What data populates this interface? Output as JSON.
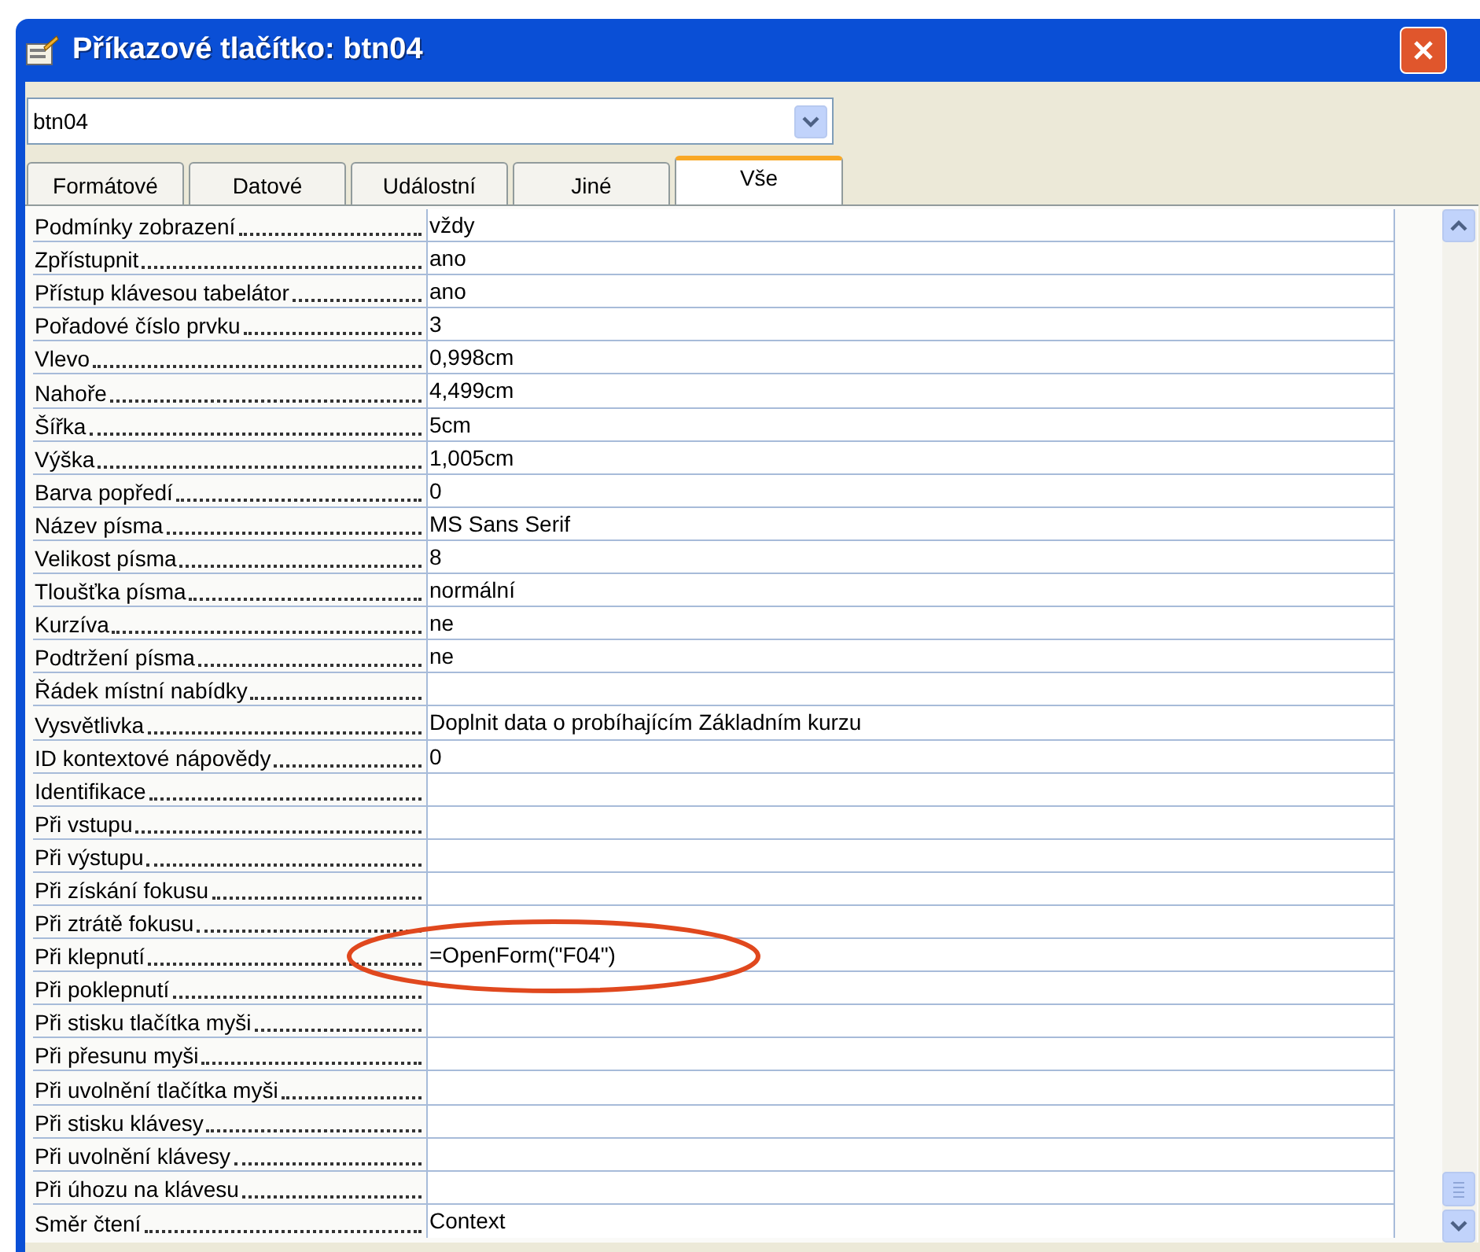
{
  "window": {
    "title": "Příkazové tlačítko: btn04"
  },
  "object_select": {
    "value": "btn04"
  },
  "tabs": [
    {
      "label": "Formátové",
      "selected": false
    },
    {
      "label": "Datové",
      "selected": false
    },
    {
      "label": "Událostní",
      "selected": false
    },
    {
      "label": "Jiné",
      "selected": false
    },
    {
      "label": "Vše",
      "selected": true
    }
  ],
  "properties": [
    {
      "name": "Podmínky zobrazení",
      "value": "vždy",
      "circled": false
    },
    {
      "name": "Zpřístupnit",
      "value": "ano",
      "circled": false
    },
    {
      "name": "Přístup klávesou tabelátor",
      "value": "ano",
      "circled": false
    },
    {
      "name": "Pořadové číslo prvku",
      "value": "3",
      "circled": false
    },
    {
      "name": "Vlevo",
      "value": "0,998cm",
      "circled": false
    },
    {
      "name": "Nahoře",
      "value": "4,499cm",
      "circled": false
    },
    {
      "name": "Šířka",
      "value": "5cm",
      "circled": false
    },
    {
      "name": "Výška",
      "value": "1,005cm",
      "circled": false
    },
    {
      "name": "Barva popředí",
      "value": "0",
      "circled": false
    },
    {
      "name": "Název písma",
      "value": "MS Sans Serif",
      "circled": false
    },
    {
      "name": "Velikost písma",
      "value": "8",
      "circled": false
    },
    {
      "name": "Tloušťka písma",
      "value": "normální",
      "circled": false
    },
    {
      "name": "Kurzíva",
      "value": "ne",
      "circled": false
    },
    {
      "name": "Podtržení písma",
      "value": "ne",
      "circled": false
    },
    {
      "name": "Řádek místní nabídky",
      "circled": false
    },
    {
      "name": "Vysvětlivka",
      "value": "Doplnit data o probíhajícím Základním kurzu",
      "circled": false
    },
    {
      "name": "ID kontextové nápovědy",
      "value": "0",
      "circled": false
    },
    {
      "name": "Identifikace",
      "circled": false
    },
    {
      "name": "Při vstupu",
      "circled": false
    },
    {
      "name": "Při výstupu",
      "circled": false
    },
    {
      "name": "Při získání fokusu",
      "circled": false
    },
    {
      "name": "Při ztrátě fokusu",
      "circled": false
    },
    {
      "name": "Při klepnutí",
      "value": "=OpenForm(\"F04\")",
      "circled": true
    },
    {
      "name": "Při poklepnutí",
      "circled": false
    },
    {
      "name": "Při stisku tlačítka myši",
      "circled": false
    },
    {
      "name": "Při přesunu myši",
      "circled": false
    },
    {
      "name": "Při uvolnění tlačítka myši",
      "circled": false
    },
    {
      "name": "Při stisku klávesy",
      "circled": false
    },
    {
      "name": "Při uvolnění klávesy",
      "circled": false
    },
    {
      "name": "Při úhozu na klávesu",
      "circled": false
    },
    {
      "name": "Směr čtení",
      "value": "Context",
      "circled": false
    }
  ]
}
